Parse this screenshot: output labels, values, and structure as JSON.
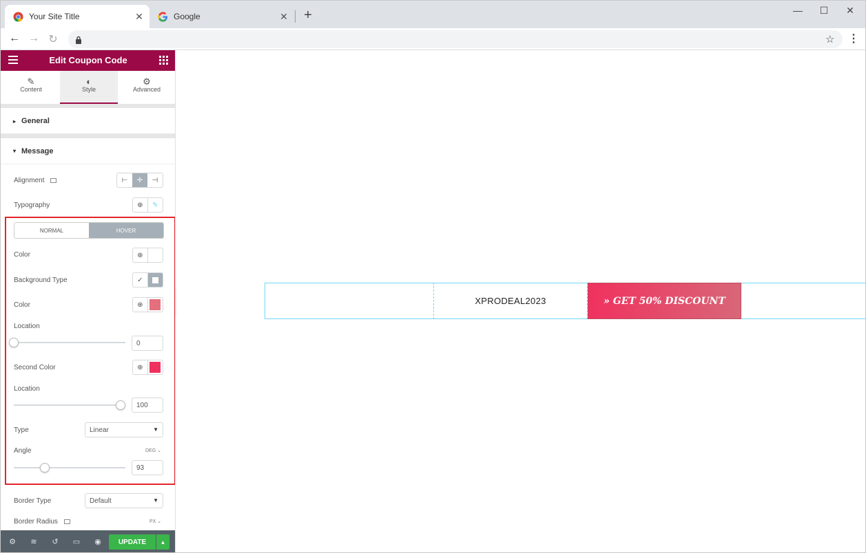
{
  "browser": {
    "tabs": [
      {
        "title": "Your Site Title",
        "close": "✕"
      },
      {
        "title": "Google",
        "close": "✕"
      }
    ],
    "new_tab": "+",
    "window": {
      "minimize": "—",
      "maximize": "☐",
      "close": "✕"
    },
    "nav": {
      "back": "←",
      "forward": "→",
      "reload": "↻"
    },
    "bookmark": "☆",
    "menu": "⋮"
  },
  "panel": {
    "header_title": "Edit Coupon Code",
    "tabs": [
      {
        "label": "Content",
        "icon": "✎"
      },
      {
        "label": "Style",
        "icon": "◐"
      },
      {
        "label": "Advanced",
        "icon": "⚙"
      }
    ],
    "sections": {
      "general": "General",
      "message": "Message"
    },
    "caret_closed": "▸",
    "caret_open": "▾",
    "labels": {
      "alignment": "Alignment",
      "typography": "Typography",
      "color": "Color",
      "background_type": "Background Type",
      "color2": "Color",
      "location": "Location",
      "second_color": "Second Color",
      "location2": "Location",
      "type": "Type",
      "angle": "Angle",
      "border_type": "Border Type",
      "border_radius": "Border Radius"
    },
    "state_toggle": {
      "normal": "NORMAL",
      "hover": "HOVER"
    },
    "values": {
      "location": "0",
      "location2": "100",
      "type": "Linear",
      "angle": "93",
      "angle_unit": "DEG ⌄",
      "border_type": "Default",
      "radius_unit": "PX ⌄"
    },
    "slider_levels": {
      "location": 0,
      "location2": 1,
      "angle": 0.26
    },
    "colors": {
      "first": "#e56f7c",
      "second": "#f0315f",
      "header": "#9b0a46",
      "update": "#39b54a"
    },
    "footer": {
      "update": "UPDATE",
      "update_more": "▲"
    },
    "collapse": "‹"
  },
  "canvas": {
    "coupon_code": "XPRODEAL2023",
    "discount_label": "» GET 50% DISCOUNT"
  }
}
